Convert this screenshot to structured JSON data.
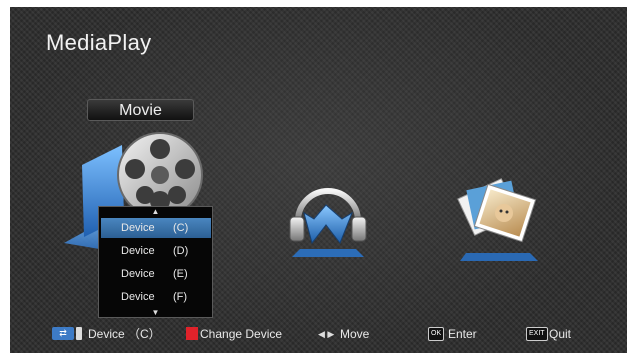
{
  "app": {
    "title": "MediaPlay"
  },
  "category": {
    "selected_label": "Movie"
  },
  "device_menu": {
    "items": [
      {
        "name": "Device",
        "drive": "(C)",
        "selected": true
      },
      {
        "name": "Device",
        "drive": "(D)",
        "selected": false
      },
      {
        "name": "Device",
        "drive": "(E)",
        "selected": false
      },
      {
        "name": "Device",
        "drive": "(F)",
        "selected": false
      }
    ]
  },
  "footer": {
    "current_device": "Device  （C）",
    "change_device": "Change Device",
    "move": "Move",
    "enter_key": "OK",
    "enter": "Enter",
    "quit_key": "EXIT",
    "quit": "Quit"
  },
  "colors": {
    "selection": "#3a73ad",
    "red_key": "#e0222a",
    "usb_key": "#3d7bc6"
  }
}
